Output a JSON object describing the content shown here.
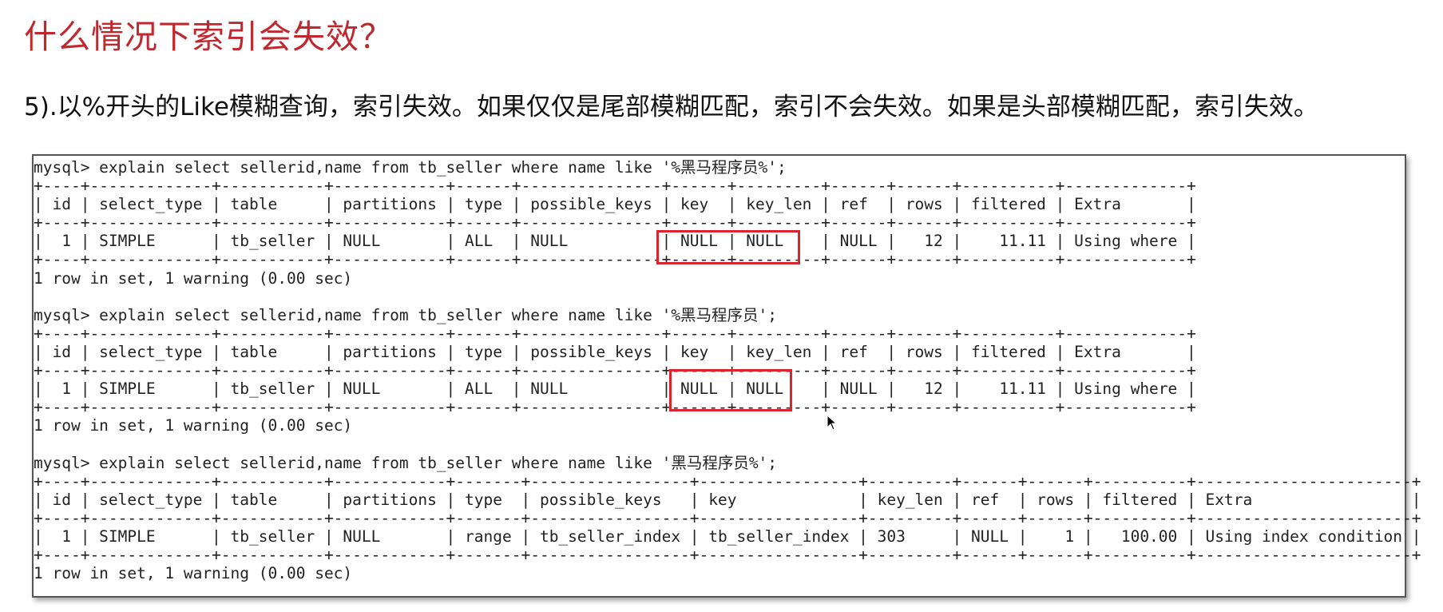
{
  "slide": {
    "title": "什么情况下索引会失效？",
    "subtitle": "5).以%开头的Like模糊查询，索引失效。如果仅仅是尾部模糊匹配，索引不会失效。如果是头部模糊匹配，索引失效。"
  },
  "terminal": {
    "lines": [
      "mysql> explain select sellerid,name from tb_seller where name like '%黑马程序员%';",
      "+----+-------------+-----------+------------+------+---------------+------+---------+------+------+----------+-------------+",
      "| id | select_type | table     | partitions | type | possible_keys | key  | key_len | ref  | rows | filtered | Extra       |",
      "+----+-------------+-----------+------------+------+---------------+------+---------+------+------+----------+-------------+",
      "|  1 | SIMPLE      | tb_seller | NULL       | ALL  | NULL          | NULL | NULL    | NULL |   12 |    11.11 | Using where |",
      "+----+-------------+-----------+------------+------+---------------+------+---------+------+------+----------+-------------+",
      "1 row in set, 1 warning (0.00 sec)",
      "",
      "mysql> explain select sellerid,name from tb_seller where name like '%黑马程序员';",
      "+----+-------------+-----------+------------+------+---------------+------+---------+------+------+----------+-------------+",
      "| id | select_type | table     | partitions | type | possible_keys | key  | key_len | ref  | rows | filtered | Extra       |",
      "+----+-------------+-----------+------------+------+---------------+------+---------+------+------+----------+-------------+",
      "|  1 | SIMPLE      | tb_seller | NULL       | ALL  | NULL          | NULL | NULL    | NULL |   12 |    11.11 | Using where |",
      "+----+-------------+-----------+------------+------+---------------+------+---------+------+------+----------+-------------+",
      "1 row in set, 1 warning (0.00 sec)",
      "",
      "mysql> explain select sellerid,name from tb_seller where name like '黑马程序员%';",
      "+----+-------------+-----------+------------+-------+-----------------+-----------------+---------+------+------+----------+-----------------------+",
      "| id | select_type | table     | partitions | type  | possible_keys   | key             | key_len | ref  | rows | filtered | Extra                 |",
      "+----+-------------+-----------+------------+-------+-----------------+-----------------+---------+------+------+----------+-----------------------+",
      "|  1 | SIMPLE      | tb_seller | NULL       | range | tb_seller_index | tb_seller_index | 303     | NULL |    1 |   100.00 | Using index condition |",
      "+----+-------------+-----------+------------+-------+-----------------+-----------------+---------+------+------+----------+-----------------------+",
      "1 row in set, 1 warning (0.00 sec)"
    ]
  }
}
